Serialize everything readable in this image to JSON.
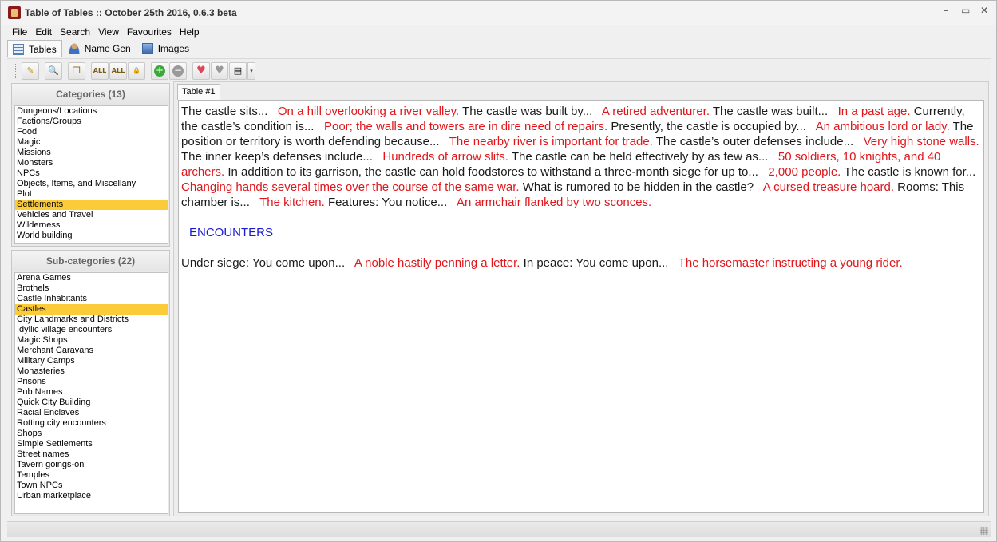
{
  "window": {
    "title": "Table of Tables :: October 25th 2016, 0.6.3 beta",
    "controls": [
      "–",
      "▭",
      "✕"
    ]
  },
  "menu": [
    "File",
    "Edit",
    "Search",
    "View",
    "Favourites",
    "Help"
  ],
  "main_tabs": [
    {
      "label": "Tables",
      "icon": "table-icon",
      "active": true
    },
    {
      "label": "Name Gen",
      "icon": "person-icon",
      "active": false
    },
    {
      "label": "Images",
      "icon": "image-icon",
      "active": false
    }
  ],
  "toolbar": {
    "buttons": [
      {
        "icon": "wand-icon",
        "glyph": "✎"
      },
      {
        "icon": "search-icon",
        "glyph": "🔍"
      },
      {
        "icon": "copy-icon",
        "glyph": "❐"
      },
      {
        "icon": "lock-all-icon",
        "glyph": "ALL"
      },
      {
        "icon": "unlock-all-icon",
        "glyph": "ALL"
      },
      {
        "icon": "lock-icon",
        "glyph": "🔒"
      },
      {
        "icon": "add-icon",
        "glyph": "+"
      },
      {
        "icon": "remove-icon",
        "glyph": "−"
      },
      {
        "icon": "favourite-add-icon",
        "glyph": "♥"
      },
      {
        "icon": "favourite-remove-icon",
        "glyph": "♥"
      },
      {
        "icon": "speech-icon",
        "glyph": "▤"
      }
    ],
    "dropdown_glyph": "▾"
  },
  "categories": {
    "header": "Categories (13)",
    "items": [
      "Dungeons/Locations",
      "Factions/Groups",
      "Food",
      "Magic",
      "Missions",
      "Monsters",
      "NPCs",
      "Objects, Items, and Miscellany",
      "Plot",
      "Settlements",
      "Vehicles and Travel",
      "Wilderness",
      "World building"
    ],
    "selected": "Settlements"
  },
  "subcategories": {
    "header": "Sub-categories (22)",
    "items": [
      "Arena Games",
      "Brothels",
      "Castle Inhabitants",
      "Castles",
      "City Landmarks and Districts",
      "Idyllic village encounters",
      "Magic Shops",
      "Merchant Caravans",
      "Military Camps",
      "Monasteries",
      "Prisons",
      "Pub Names",
      "Quick City Building",
      "Racial Enclaves",
      "Rotting city encounters",
      "Shops",
      "Simple Settlements",
      "Street names",
      "Tavern goings-on",
      "Temples",
      "Town NPCs",
      "Urban marketplace"
    ],
    "selected": "Castles"
  },
  "content": {
    "tab_label": "Table #1",
    "paragraph1": [
      {
        "style": "black",
        "text": "The castle sits...  "
      },
      {
        "style": "red",
        "text": " On a hill overlooking a river valley."
      },
      {
        "style": "black",
        "text": " The castle was built by...  "
      },
      {
        "style": "red",
        "text": " A retired adventurer."
      },
      {
        "style": "black",
        "text": " The castle was built...  "
      },
      {
        "style": "red",
        "text": " In a past age."
      },
      {
        "style": "black",
        "text": " Currently, the castle’s condition is...  "
      },
      {
        "style": "red",
        "text": " Poor; the walls and towers are in dire need of repairs."
      },
      {
        "style": "black",
        "text": " Presently, the castle is occupied by...  "
      },
      {
        "style": "red",
        "text": " An ambitious lord or lady."
      },
      {
        "style": "black",
        "text": " The position or territory is worth defending because...  "
      },
      {
        "style": "red",
        "text": " The nearby river is important for trade."
      },
      {
        "style": "black",
        "text": " The castle’s outer defenses include...  "
      },
      {
        "style": "red",
        "text": " Very high stone walls."
      },
      {
        "style": "black",
        "text": " The inner keep’s defenses include...  "
      },
      {
        "style": "red",
        "text": " Hundreds of arrow slits."
      },
      {
        "style": "black",
        "text": " The castle can be held effectively by as few as...  "
      },
      {
        "style": "red",
        "text": " 50 soldiers, 10 knights, and 40 archers."
      },
      {
        "style": "black",
        "text": " In addition to its garrison, the castle can hold foodstores to withstand a three-month siege for up to...  "
      },
      {
        "style": "red",
        "text": " 2,000 people."
      },
      {
        "style": "black",
        "text": " The castle is known for...  "
      },
      {
        "style": "red",
        "text": " Changing hands several times over the course of the same war."
      },
      {
        "style": "black",
        "text": " What is rumored to be hidden in the castle?  "
      },
      {
        "style": "red",
        "text": " A cursed treasure hoard."
      },
      {
        "style": "black",
        "text": " Rooms: This chamber is...  "
      },
      {
        "style": "red",
        "text": " The kitchen."
      },
      {
        "style": "black",
        "text": " Features: You notice...  "
      },
      {
        "style": "red",
        "text": " An armchair flanked by two sconces."
      }
    ],
    "heading": "ENCOUNTERS",
    "paragraph2": [
      {
        "style": "black",
        "text": "Under siege: You come upon...  "
      },
      {
        "style": "red",
        "text": " A noble hastily penning a letter."
      },
      {
        "style": "black",
        "text": " In peace: You come upon...  "
      },
      {
        "style": "red",
        "text": " The horsemaster instructing a young rider."
      }
    ]
  },
  "colors": {
    "selection": "#fbcb3a",
    "result_text": "#e0161b",
    "heading_text": "#1a1ad6"
  }
}
